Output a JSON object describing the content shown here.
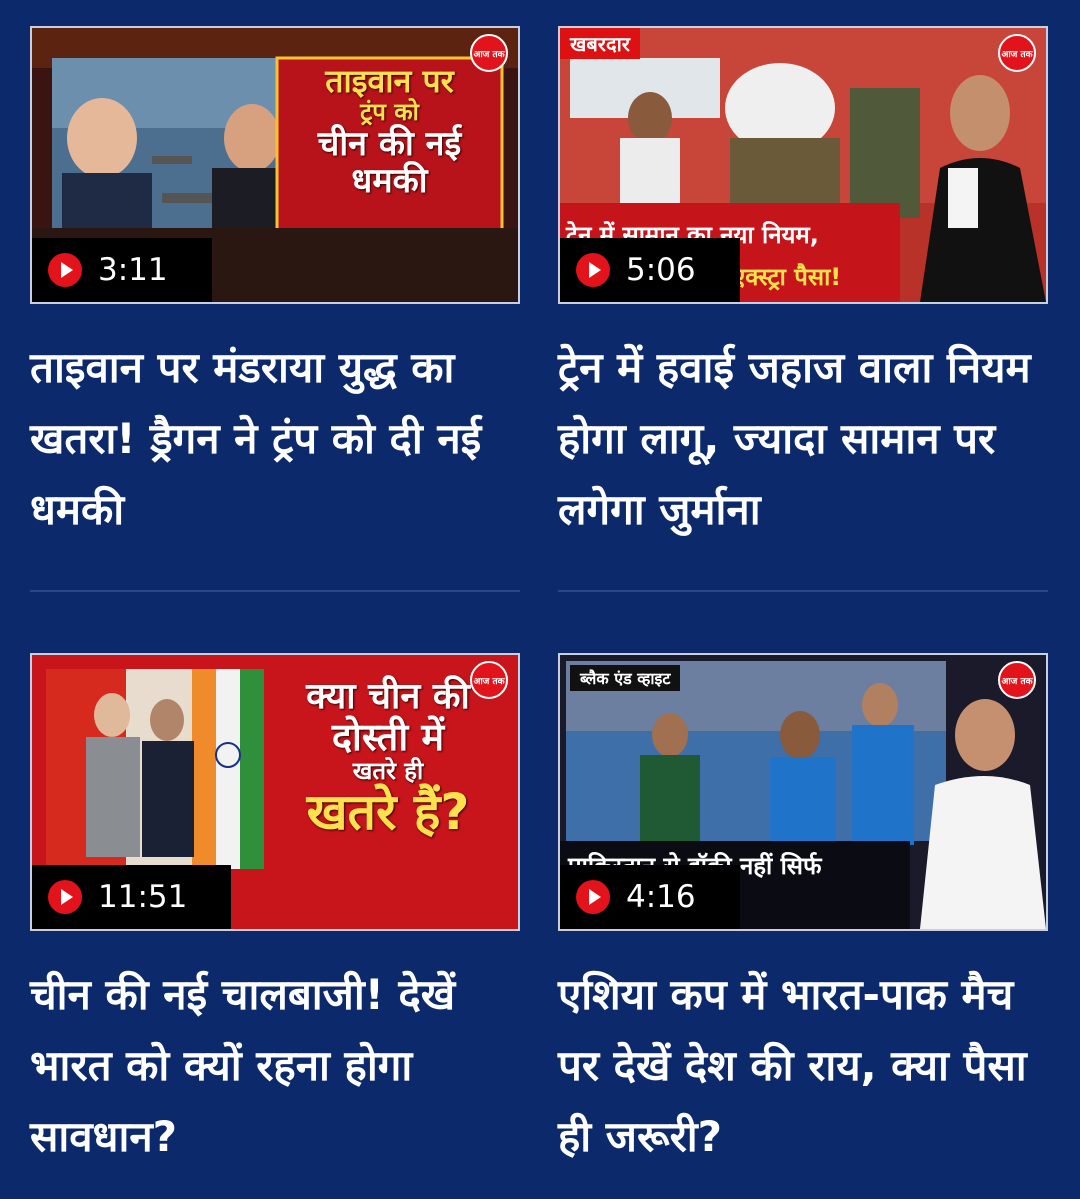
{
  "brand": {
    "logo_text": "आज तक"
  },
  "colors": {
    "background": "#0c2a6b",
    "play_red": "#e3131b",
    "divider": "#2a4684"
  },
  "videos": [
    {
      "duration": "3:11",
      "title": "ताइवान पर मंडराया युद्ध का खतरा! ड्रैगन ने ट्रंप को दी नई धमकी",
      "thumb_lines": [
        "ताइवान पर",
        "ट्रंप को",
        "चीन की नई",
        "धमकी"
      ]
    },
    {
      "duration": "5:06",
      "title": "ट्रेन में हवाई जहाज वाला नियम होगा लागू, ज्यादा सामान पर लगेगा जुर्माना",
      "thumb_tag": "खबरदार",
      "thumb_strip_1": "ट्रेन में सामान का नया नियम,",
      "thumb_strip_2": "एक्स्ट्रा पैसा!"
    },
    {
      "duration": "11:51",
      "title": "चीन की नई चालबाजी! देखें भारत को क्यों रहना होगा सावधान?",
      "thumb_lines": [
        "क्या चीन की",
        "दोस्ती में",
        "खतरे ही",
        "खतरे हैं?"
      ]
    },
    {
      "duration": "4:16",
      "title": "एशिया कप में भारत-पाक मैच पर देखें देश की राय, क्या पैसा ही जरूरी?",
      "thumb_tag": "ब्लैक एंड व्हाइट",
      "thumb_strip_1": "पाकिस्तान से हॉकी नहीं सिर्फ",
      "thumb_strip_2": "!"
    }
  ]
}
